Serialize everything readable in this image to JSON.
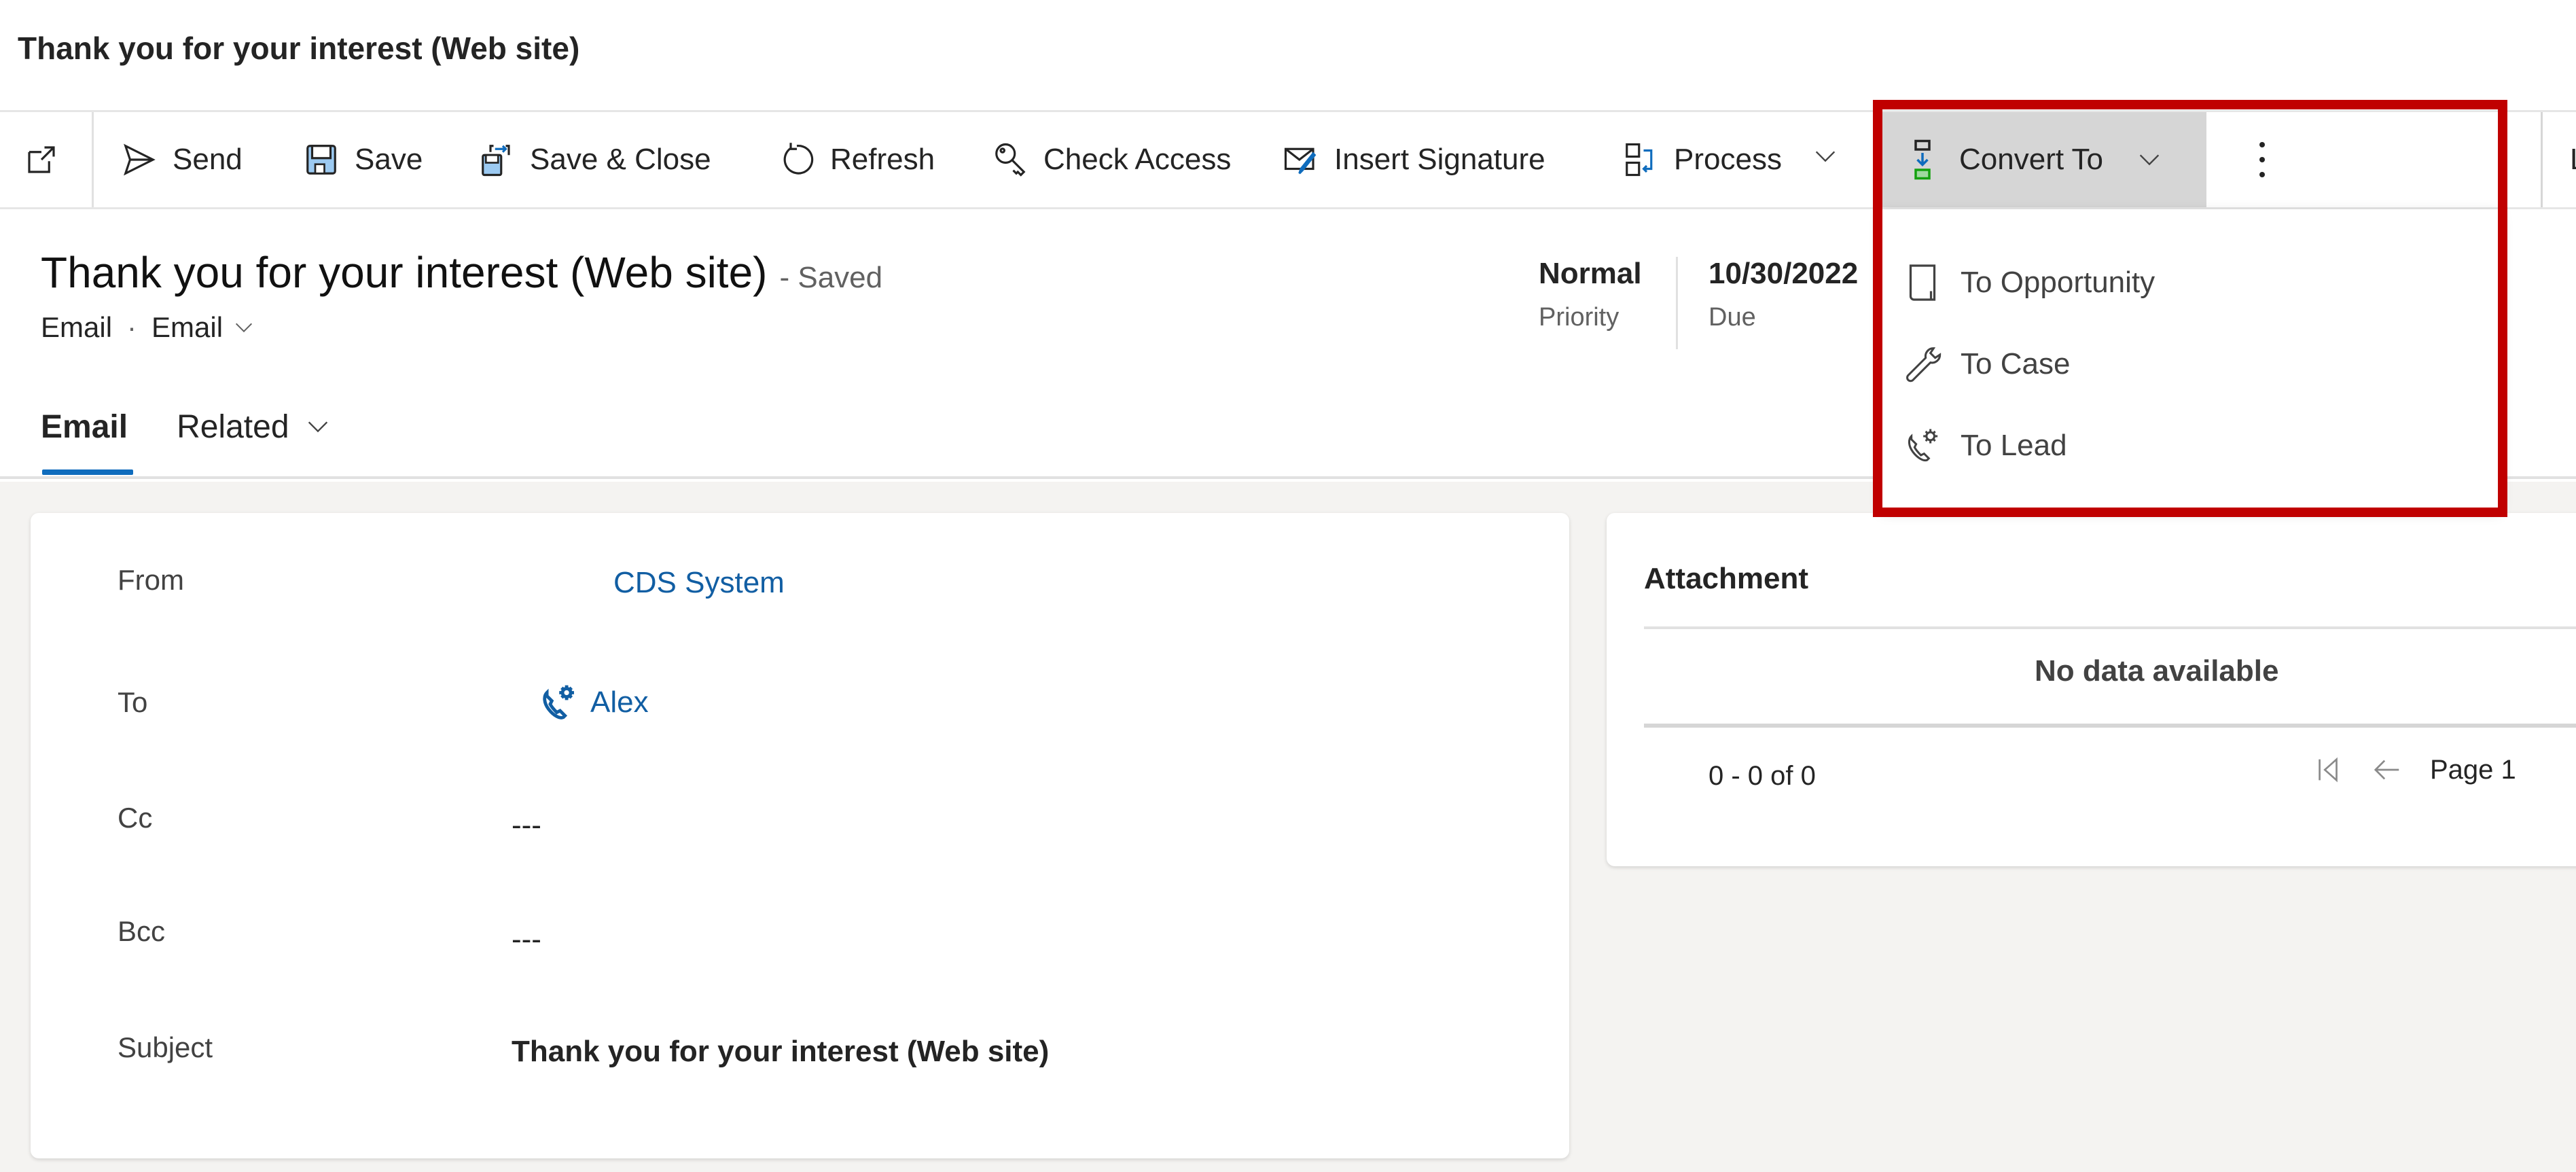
{
  "window": {
    "title": "Thank you for your interest (Web site)"
  },
  "toolbar": {
    "popout_icon": "popout-icon",
    "items": [
      {
        "label": "Send",
        "icon": "send-icon"
      },
      {
        "label": "Save",
        "icon": "save-icon"
      },
      {
        "label": "Save & Close",
        "icon": "save-close-icon"
      },
      {
        "label": "Refresh",
        "icon": "refresh-icon"
      },
      {
        "label": "Check Access",
        "icon": "key-search-icon"
      },
      {
        "label": "Insert Signature",
        "icon": "signature-icon"
      },
      {
        "label": "Process",
        "icon": "process-icon",
        "has_dropdown": true
      }
    ],
    "convert_to": {
      "label": "Convert To",
      "icon": "convert-icon",
      "expanded": true
    },
    "more_icon": "more-vertical-icon",
    "clipped_next_label": "L"
  },
  "convert_menu": {
    "items": [
      {
        "label": "To Opportunity",
        "icon": "opportunity-icon"
      },
      {
        "label": "To Case",
        "icon": "wrench-icon"
      },
      {
        "label": "To Lead",
        "icon": "lead-icon"
      }
    ]
  },
  "record": {
    "title": "Thank you for your interest (Web site)",
    "save_status": "- Saved",
    "entity": "Email",
    "form": "Email",
    "priority": {
      "value": "Normal",
      "label": "Priority"
    },
    "due": {
      "value": "10/30/2022",
      "label": "Due"
    }
  },
  "tabs": [
    {
      "label": "Email",
      "active": true
    },
    {
      "label": "Related",
      "active": false,
      "has_dropdown": true
    }
  ],
  "form": {
    "fields": [
      {
        "label": "From",
        "value": "CDS System",
        "type": "link"
      },
      {
        "label": "To",
        "value": "Alex",
        "type": "link",
        "icon": "lead-icon"
      },
      {
        "label": "Cc",
        "value": "---",
        "type": "text"
      },
      {
        "label": "Bcc",
        "value": "---",
        "type": "text"
      },
      {
        "label": "Subject",
        "value": "Thank you for your interest (Web site)",
        "type": "bold"
      }
    ]
  },
  "attachment": {
    "title": "Attachment",
    "empty_message": "No data available",
    "record_count": "0 - 0 of 0",
    "page_label": "Page 1"
  },
  "colors": {
    "accent": "#0f6cbd",
    "link": "#115ea3",
    "highlight_border": "#c00000",
    "pressed_button": "#d6d6d6",
    "content_bg": "#f4f3f1"
  }
}
